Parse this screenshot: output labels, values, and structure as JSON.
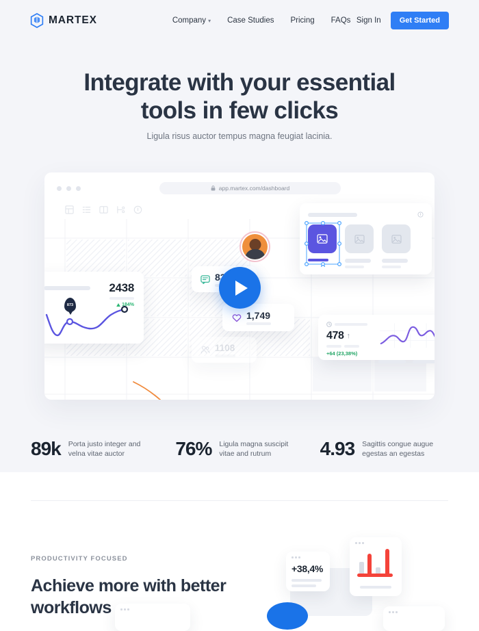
{
  "brand": {
    "name": "MARTEX",
    "logo_icon": "hexagon-cube-icon",
    "accent": "#2f7ef5"
  },
  "nav": {
    "links": [
      {
        "label": "Company",
        "has_dropdown": true,
        "caret": "▾"
      },
      {
        "label": "Case Studies",
        "has_dropdown": false
      },
      {
        "label": "Pricing",
        "has_dropdown": false
      },
      {
        "label": "FAQs",
        "has_dropdown": false
      }
    ],
    "signin_label": "Sign In",
    "cta_label": "Get Started"
  },
  "hero": {
    "title_line1": "Integrate with your essential",
    "title_line2": "tools in few clicks",
    "subtitle": "Ligula risus auctor tempus magna feugiat lacinia."
  },
  "mockup": {
    "url": "app.martex.com/dashboard",
    "lock_icon": "lock-icon",
    "toolbar_icons": [
      "table-icon",
      "list-icon",
      "columns-icon",
      "flow-icon",
      "info-icon"
    ],
    "play_button_label": "play-icon",
    "cards": {
      "trend": {
        "value": "2438",
        "delta": "184%",
        "delta_icon": "triangle-up-icon",
        "tooltip": "873"
      },
      "comments": {
        "value": "839",
        "icon": "chat-icon",
        "icon_color": "#3bb89a"
      },
      "likes": {
        "value": "1,749",
        "icon": "heart-icon",
        "icon_color": "#8b4fd6"
      },
      "users": {
        "value": "1108",
        "icon": "users-icon"
      },
      "gallery": {
        "info_icon": "info-icon",
        "thumb_icon": "image-icon",
        "selected_index": 0,
        "thumb_count": 3
      },
      "purple": {
        "value": "478",
        "arrow": "↑",
        "delta": "+64 (23,38%)"
      }
    },
    "avatar": "user-avatar"
  },
  "stats": [
    {
      "value": "89k",
      "text": "Porta justo integer and velna vitae auctor"
    },
    {
      "value": "76%",
      "text": "Ligula magna suscipit vitae and rutrum"
    },
    {
      "value": "4.93",
      "text": "Sagittis congue augue egestas an egestas"
    }
  ],
  "lower": {
    "eyebrow": "PRODUCTIVITY FOCUSED",
    "title": "Achieve more with better workflows",
    "cards": {
      "percent": "+38,4%",
      "bar_chart_color": "#f4433a"
    }
  },
  "chart_data": [
    {
      "type": "line",
      "title": "2438",
      "series": [
        {
          "name": "trend",
          "values": [
            38,
            72,
            48,
            40,
            46,
            52,
            40,
            22,
            18
          ]
        }
      ],
      "x": [
        0,
        1,
        2,
        3,
        4,
        5,
        6,
        7,
        8
      ],
      "ylabel": "",
      "xlabel": "",
      "grid": false,
      "annotations": [
        "873",
        "184%"
      ],
      "color": "#5b55e0"
    },
    {
      "type": "line",
      "title": "478",
      "series": [
        {
          "name": "purple-spark",
          "values": [
            28,
            18,
            12,
            20,
            30,
            6,
            14,
            8,
            16,
            30
          ]
        }
      ],
      "x": [
        0,
        1,
        2,
        3,
        4,
        5,
        6,
        7,
        8,
        9
      ],
      "ylabel": "",
      "xlabel": "",
      "grid": true,
      "annotations": [
        "+64 (23,38%)"
      ],
      "color": "#7b5ce0"
    },
    {
      "type": "bar",
      "title": "",
      "categories": [
        "a",
        "b",
        "c",
        "d"
      ],
      "series": [
        {
          "name": "base",
          "values": [
            26,
            0,
            14,
            0
          ],
          "color": "#d8dce5"
        },
        {
          "name": "highlight",
          "values": [
            0,
            40,
            0,
            52
          ],
          "color": "#f4433a"
        }
      ],
      "ylabel": "",
      "xlabel": "",
      "grid": false
    }
  ]
}
